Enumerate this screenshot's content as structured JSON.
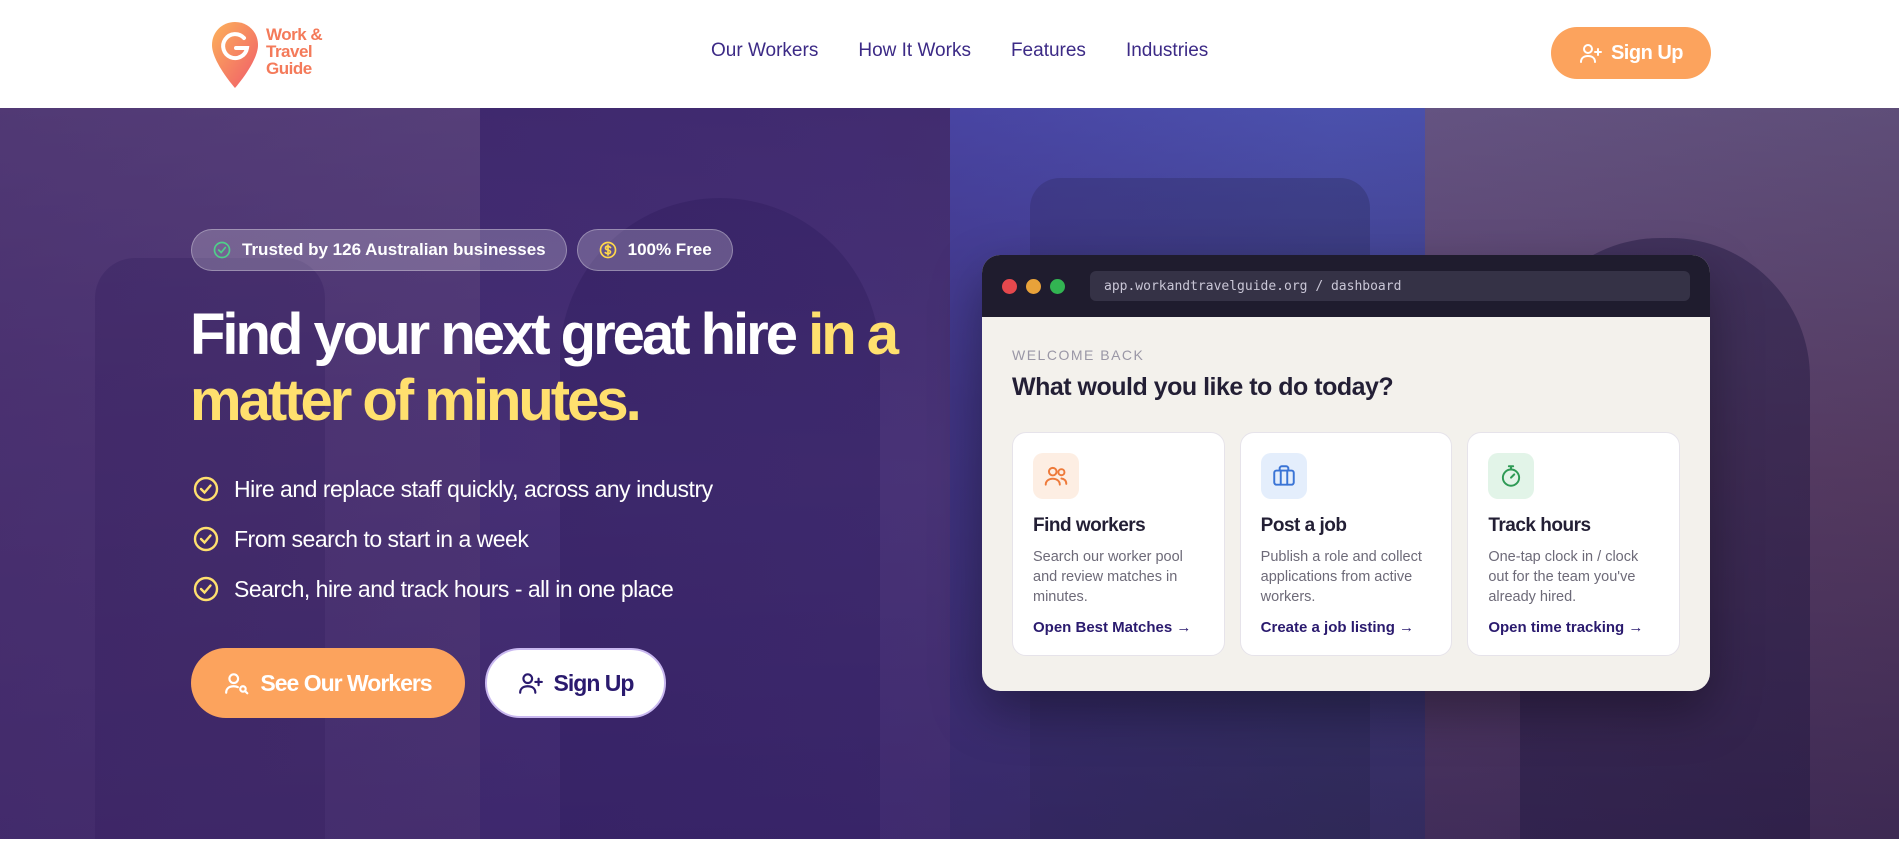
{
  "logo": {
    "lines": [
      "Work &",
      "Travel",
      "Guide"
    ],
    "color": "#f47a5a"
  },
  "nav": {
    "links": [
      "Our Workers",
      "How It Works",
      "Features",
      "Industries"
    ],
    "signup_label": "Sign Up",
    "signup_icon": "user-plus-icon"
  },
  "hero": {
    "badges": [
      {
        "icon": "check-circle-icon",
        "label": "Trusted by 126 Australian businesses"
      },
      {
        "icon": "dollar-coin-icon",
        "label": "100% Free"
      }
    ],
    "headline_white": "Find your next great hire",
    "headline_yellow": "in a matter of minutes.",
    "bullets": [
      "Hire and replace staff quickly, across any industry",
      "From search to start in a week",
      "Search, hire and track hours - all in one place"
    ],
    "cta_primary": "See Our Workers",
    "cta_secondary": "Sign Up",
    "accent": "#fca35d",
    "highlight": "#ffe06e"
  },
  "dashboard": {
    "url": "app.workandtravelguide.org / dashboard",
    "welcome": "WELCOME BACK",
    "title": "What would you like to do today?",
    "cards": [
      {
        "icon": "users-icon",
        "title": "Find workers",
        "desc": "Search our worker pool and review matches in minutes.",
        "link": "Open Best Matches →"
      },
      {
        "icon": "briefcase-icon",
        "title": "Post a job",
        "desc": "Publish a role and collect applications from active workers.",
        "link": "Create a job listing →"
      },
      {
        "icon": "stopwatch-icon",
        "title": "Track hours",
        "desc": "One-tap clock in / clock out for the team you've already hired.",
        "link": "Open time tracking →"
      }
    ]
  }
}
